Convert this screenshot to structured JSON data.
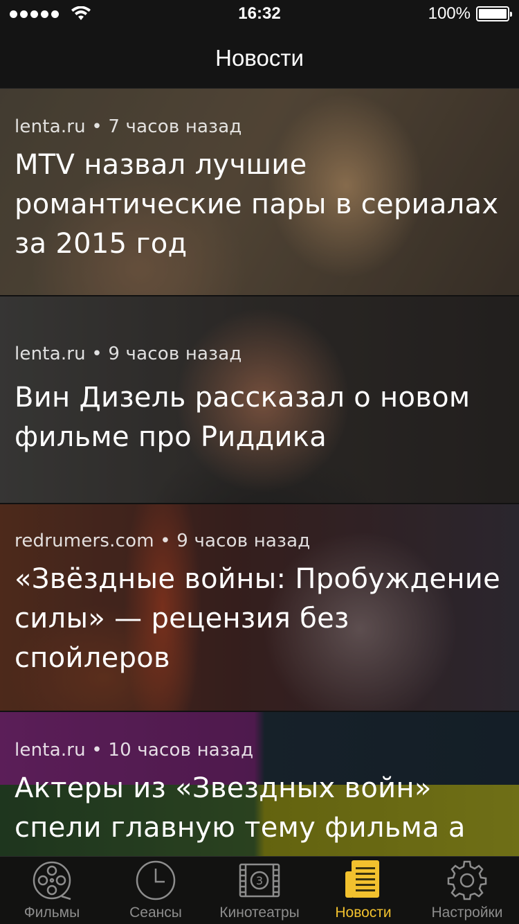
{
  "status_bar": {
    "time": "16:32",
    "battery": "100%"
  },
  "nav": {
    "title": "Новости"
  },
  "news": [
    {
      "source": "lenta.ru",
      "separator": "•",
      "time": "7 часов назад",
      "title": "MTV назвал лучшие романтические пары в сериалах за 2015 год"
    },
    {
      "source": "lenta.ru",
      "separator": "•",
      "time": "9 часов назад",
      "title": "Вин Дизель рассказал о новом фильме про Риддика"
    },
    {
      "source": "redrumers.com",
      "separator": "•",
      "time": "9 часов назад",
      "title": "«Звёздные войны: Пробуждение силы» — рецензия без спойлеров"
    },
    {
      "source": "lenta.ru",
      "separator": "•",
      "time": "10 часов назад",
      "title": "Актеры из «Звездных войн» спели главную тему фильма а"
    }
  ],
  "tabs": [
    {
      "label": "Фильмы",
      "icon": "film-reel-icon"
    },
    {
      "label": "Сеансы",
      "icon": "clock-icon"
    },
    {
      "label": "Кинотеатры",
      "icon": "cinema-icon"
    },
    {
      "label": "Новости",
      "icon": "newspaper-icon",
      "active": true
    },
    {
      "label": "Настройки",
      "icon": "gear-icon"
    }
  ],
  "colors": {
    "accent": "#f2c12e",
    "inactive": "#8d8d8d",
    "bar": "#141414"
  }
}
